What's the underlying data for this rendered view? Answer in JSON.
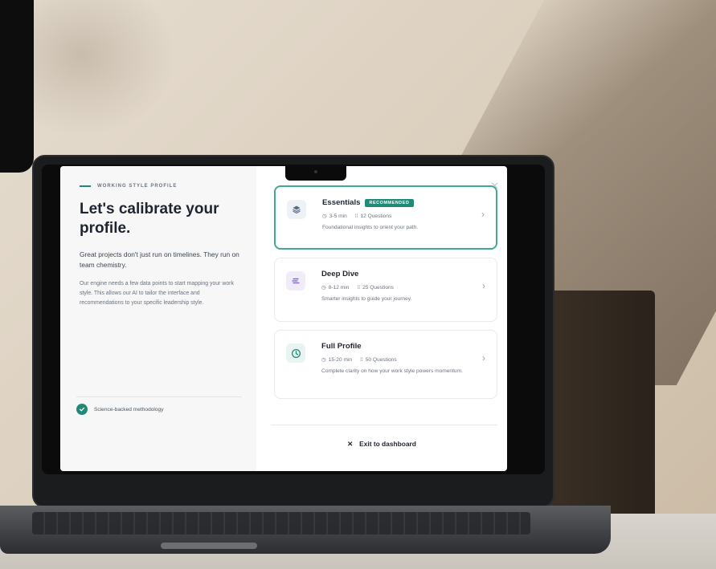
{
  "left": {
    "eyebrow": "WORKING STYLE PROFILE",
    "headline": "Let's calibrate your profile.",
    "lead": "Great projects don't just run on timelines. They run on team chemistry.",
    "body": "Our engine needs a few data points to start mapping your work style. This allows our AI to tailor the interface and recommendations to your specific leadership style.",
    "badge": "Science-backed methodology"
  },
  "cards": [
    {
      "title": "Essentials",
      "badge": "RECOMMENDED",
      "time": "3-5 min",
      "questions": "12 Questions",
      "description": "Foundational insights to orient your path.",
      "icon": "layers-icon",
      "accent": "#41a895"
    },
    {
      "title": "Deep Dive",
      "time": "8-12 min",
      "questions": "25 Questions",
      "description": "Smarter insights to guide your journey.",
      "icon": "list-lines-icon",
      "accent": "#7b57d1"
    },
    {
      "title": "Full Profile",
      "time": "15-20 min",
      "questions": "50 Questions",
      "description": "Complete clarity on how your work style powers momentum.",
      "icon": "clock-icon",
      "accent": "#1f8a78"
    }
  ],
  "exit_label": "Exit to dashboard",
  "colors": {
    "accent": "#1f8a78",
    "selected_border": "#41a895"
  }
}
